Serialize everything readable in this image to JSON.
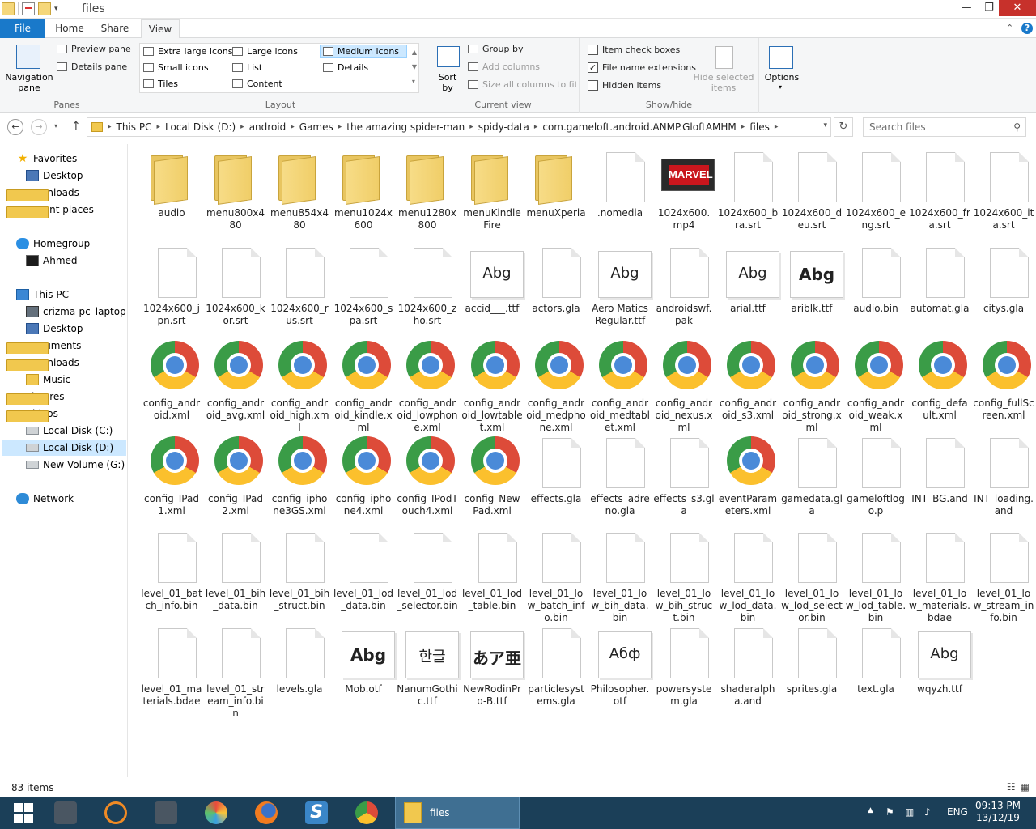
{
  "window": {
    "title": "files",
    "min_glyph": "—",
    "max_glyph": "❐",
    "close_glyph": "✕"
  },
  "tabs": [
    "File",
    "Home",
    "Share",
    "View"
  ],
  "ribbon": {
    "panes": {
      "nav_pane": "Navigation pane",
      "preview": "Preview pane",
      "details": "Details pane",
      "label": "Panes"
    },
    "layout": {
      "items": [
        "Extra large icons",
        "Large icons",
        "Medium icons",
        "Small icons",
        "List",
        "Details",
        "Tiles",
        "Content"
      ],
      "selected": "Medium icons",
      "label": "Layout"
    },
    "current_view": {
      "sort": "Sort by",
      "group": "Group by",
      "add_columns": "Add columns",
      "size_cols": "Size all columns to fit",
      "label": "Current view"
    },
    "show_hide": {
      "item_checkboxes": "Item check boxes",
      "ext": "File name extensions",
      "hidden": "Hidden items",
      "hide_selected": "Hide selected items",
      "label": "Show/hide"
    },
    "options": "Options"
  },
  "address": {
    "crumbs": [
      "This PC",
      "Local Disk (D:)",
      "android",
      "Games",
      "the amazing spider-man",
      "spidy-data",
      "com.gameloft.android.ANMP.GloftAMHM",
      "files"
    ]
  },
  "search": {
    "placeholder": "Search files"
  },
  "nav": [
    {
      "label": "Favorites",
      "icon": "star-icon",
      "indent": 0
    },
    {
      "label": "Desktop",
      "icon": "desktop-icon",
      "indent": 1
    },
    {
      "label": "Downloads",
      "icon": "downloads-icon",
      "indent": 1
    },
    {
      "label": "Recent places",
      "icon": "recent-places-icon",
      "indent": 1
    },
    {
      "label": "Homegroup",
      "icon": "homegroup-icon",
      "indent": 0
    },
    {
      "label": "Ahmed",
      "icon": "user-icon",
      "indent": 1
    },
    {
      "label": "This PC",
      "icon": "pc-icon",
      "indent": 0
    },
    {
      "label": "crizma-pc_laptop (c",
      "icon": "computer-icon",
      "indent": 1
    },
    {
      "label": "Desktop",
      "icon": "desktop-icon",
      "indent": 1
    },
    {
      "label": "Documents",
      "icon": "documents-icon",
      "indent": 1
    },
    {
      "label": "Downloads",
      "icon": "downloads-icon",
      "indent": 1
    },
    {
      "label": "Music",
      "icon": "music-icon",
      "indent": 1
    },
    {
      "label": "Pictures",
      "icon": "pictures-icon",
      "indent": 1
    },
    {
      "label": "Videos",
      "icon": "videos-icon",
      "indent": 1
    },
    {
      "label": "Local Disk (C:)",
      "icon": "disk-icon",
      "indent": 1
    },
    {
      "label": "Local Disk (D:)",
      "icon": "disk-icon",
      "indent": 1,
      "selected": true
    },
    {
      "label": "New Volume (G:)",
      "icon": "disk-icon",
      "indent": 1
    },
    {
      "label": "Network",
      "icon": "network-icon",
      "indent": 0
    }
  ],
  "files": [
    {
      "name": "audio",
      "type": "folder"
    },
    {
      "name": "menu800x480",
      "type": "folder"
    },
    {
      "name": "menu854x480",
      "type": "folder"
    },
    {
      "name": "menu1024x600",
      "type": "folder"
    },
    {
      "name": "menu1280x800",
      "type": "folder"
    },
    {
      "name": "menuKindleFire",
      "type": "folder"
    },
    {
      "name": "menuXperia",
      "type": "folder"
    },
    {
      "name": ".nomedia",
      "type": "doc"
    },
    {
      "name": "1024x600.mp4",
      "type": "video"
    },
    {
      "name": "1024x600_bra.srt",
      "type": "doc"
    },
    {
      "name": "1024x600_deu.srt",
      "type": "doc"
    },
    {
      "name": "1024x600_eng.srt",
      "type": "doc"
    },
    {
      "name": "1024x600_fra.srt",
      "type": "doc"
    },
    {
      "name": "1024x600_ita.srt",
      "type": "doc"
    },
    {
      "name": "1024x600_jpn.srt",
      "type": "doc"
    },
    {
      "name": "1024x600_kor.srt",
      "type": "doc"
    },
    {
      "name": "1024x600_rus.srt",
      "type": "doc"
    },
    {
      "name": "1024x600_spa.srt",
      "type": "doc"
    },
    {
      "name": "1024x600_zho.srt",
      "type": "doc"
    },
    {
      "name": "accid___.ttf",
      "type": "font",
      "glyph": "Abg",
      "bold": false
    },
    {
      "name": "actors.gla",
      "type": "doc"
    },
    {
      "name": "Aero Matics Regular.ttf",
      "type": "font",
      "glyph": "Abg",
      "bold": false
    },
    {
      "name": "androidswf.pak",
      "type": "doc"
    },
    {
      "name": "arial.ttf",
      "type": "font",
      "glyph": "Abg",
      "bold": false
    },
    {
      "name": "ariblk.ttf",
      "type": "font",
      "glyph": "Abg",
      "bold": true
    },
    {
      "name": "audio.bin",
      "type": "doc"
    },
    {
      "name": "automat.gla",
      "type": "doc"
    },
    {
      "name": "citys.gla",
      "type": "doc"
    },
    {
      "name": "config_android.xml",
      "type": "chrome"
    },
    {
      "name": "config_android_avg.xml",
      "type": "chrome"
    },
    {
      "name": "config_android_high.xml",
      "type": "chrome"
    },
    {
      "name": "config_android_kindle.xml",
      "type": "chrome"
    },
    {
      "name": "config_android_lowphone.xml",
      "type": "chrome"
    },
    {
      "name": "config_android_lowtablet.xml",
      "type": "chrome"
    },
    {
      "name": "config_android_medphone.xml",
      "type": "chrome"
    },
    {
      "name": "config_android_medtablet.xml",
      "type": "chrome"
    },
    {
      "name": "config_android_nexus.xml",
      "type": "chrome"
    },
    {
      "name": "config_android_s3.xml",
      "type": "chrome"
    },
    {
      "name": "config_android_strong.xml",
      "type": "chrome"
    },
    {
      "name": "config_android_weak.xml",
      "type": "chrome"
    },
    {
      "name": "config_default.xml",
      "type": "chrome"
    },
    {
      "name": "config_fullScreen.xml",
      "type": "chrome"
    },
    {
      "name": "config_IPad1.xml",
      "type": "chrome"
    },
    {
      "name": "config_IPad2.xml",
      "type": "chrome"
    },
    {
      "name": "config_iphone3GS.xml",
      "type": "chrome"
    },
    {
      "name": "config_iphone4.xml",
      "type": "chrome"
    },
    {
      "name": "config_IPodTouch4.xml",
      "type": "chrome"
    },
    {
      "name": "config_NewPad.xml",
      "type": "chrome"
    },
    {
      "name": "effects.gla",
      "type": "doc"
    },
    {
      "name": "effects_adreno.gla",
      "type": "doc"
    },
    {
      "name": "effects_s3.gla",
      "type": "doc"
    },
    {
      "name": "eventParameters.xml",
      "type": "chrome"
    },
    {
      "name": "gamedata.gla",
      "type": "doc"
    },
    {
      "name": "gameloftlogo.p",
      "type": "doc"
    },
    {
      "name": "INT_BG.and",
      "type": "doc"
    },
    {
      "name": "INT_loading.and",
      "type": "doc"
    },
    {
      "name": "level_01_batch_info.bin",
      "type": "doc"
    },
    {
      "name": "level_01_bih_data.bin",
      "type": "doc"
    },
    {
      "name": "level_01_bih_struct.bin",
      "type": "doc"
    },
    {
      "name": "level_01_lod_data.bin",
      "type": "doc"
    },
    {
      "name": "level_01_lod_selector.bin",
      "type": "doc"
    },
    {
      "name": "level_01_lod_table.bin",
      "type": "doc"
    },
    {
      "name": "level_01_low_batch_info.bin",
      "type": "doc"
    },
    {
      "name": "level_01_low_bih_data.bin",
      "type": "doc"
    },
    {
      "name": "level_01_low_bih_struct.bin",
      "type": "doc"
    },
    {
      "name": "level_01_low_lod_data.bin",
      "type": "doc"
    },
    {
      "name": "level_01_low_lod_selector.bin",
      "type": "doc"
    },
    {
      "name": "level_01_low_lod_table.bin",
      "type": "doc"
    },
    {
      "name": "level_01_low_materials.bdae",
      "type": "doc"
    },
    {
      "name": "level_01_low_stream_info.bin",
      "type": "doc"
    },
    {
      "name": "level_01_materials.bdae",
      "type": "doc"
    },
    {
      "name": "level_01_stream_info.bin",
      "type": "doc"
    },
    {
      "name": "levels.gla",
      "type": "doc"
    },
    {
      "name": "Mob.otf",
      "type": "font",
      "glyph": "Abg",
      "bold": true
    },
    {
      "name": "NanumGothic.ttf",
      "type": "font",
      "glyph": "한글",
      "bold": false
    },
    {
      "name": "NewRodinPro-B.ttf",
      "type": "font",
      "glyph": "あア亜",
      "bold": true
    },
    {
      "name": "particlesystems.gla",
      "type": "doc"
    },
    {
      "name": "Philosopher.otf",
      "type": "font",
      "glyph": "Абф",
      "bold": false
    },
    {
      "name": "powersystem.gla",
      "type": "doc"
    },
    {
      "name": "shaderalpha.and",
      "type": "doc"
    },
    {
      "name": "sprites.gla",
      "type": "doc"
    },
    {
      "name": "text.gla",
      "type": "doc"
    },
    {
      "name": "wqyzh.ttf",
      "type": "font",
      "glyph": "Abg",
      "bold": false
    }
  ],
  "video_badge": "MARVEL",
  "status": {
    "count": "83 items"
  },
  "taskbar": {
    "active_label": "files",
    "lang": "ENG",
    "time": "09:13 PM",
    "date": "13/12/19"
  }
}
